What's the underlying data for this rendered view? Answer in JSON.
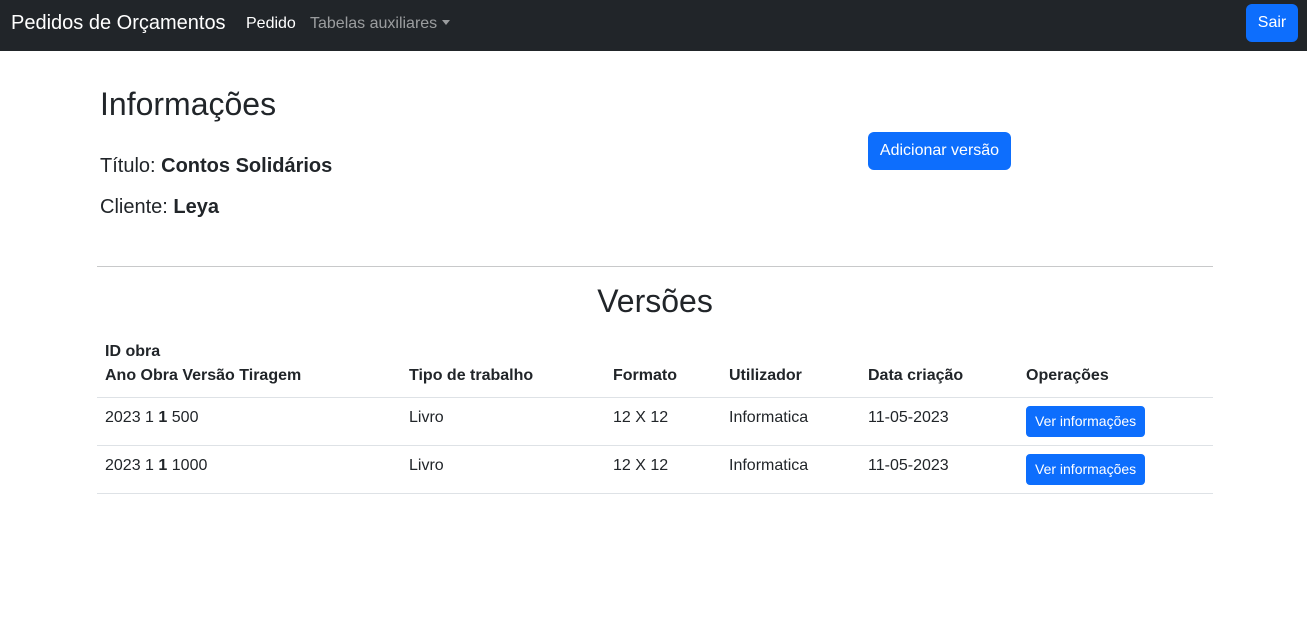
{
  "navbar": {
    "brand": "Pedidos de Orçamentos",
    "links": {
      "pedido": "Pedido",
      "tabelas": "Tabelas auxiliares"
    },
    "logout_label": "Sair"
  },
  "info": {
    "heading": "Informações",
    "titulo_label": "Título:",
    "titulo_value": "Contos Solidários",
    "cliente_label": "Cliente:",
    "cliente_value": "Leya",
    "add_version_label": "Adicionar versão"
  },
  "versions": {
    "heading": "Versões",
    "columns": {
      "id_line1": "ID obra",
      "id_line2": "Ano Obra Versão Tiragem",
      "tipo": "Tipo de trabalho",
      "formato": "Formato",
      "utilizador": "Utilizador",
      "data": "Data criação",
      "operacoes": "Operações"
    },
    "rows": [
      {
        "ano": "2023",
        "obra": "1",
        "versao": "1",
        "tiragem": "500",
        "tipo": "Livro",
        "formato": "12 X 12",
        "utilizador": "Informatica",
        "data": "11-05-2023",
        "action": "Ver informações"
      },
      {
        "ano": "2023",
        "obra": "1",
        "versao": "1",
        "tiragem": "1000",
        "tipo": "Livro",
        "formato": "12 X 12",
        "utilizador": "Informatica",
        "data": "11-05-2023",
        "action": "Ver informações"
      }
    ]
  },
  "colors": {
    "navbar_bg": "#212529",
    "primary": "#0d6efd"
  }
}
